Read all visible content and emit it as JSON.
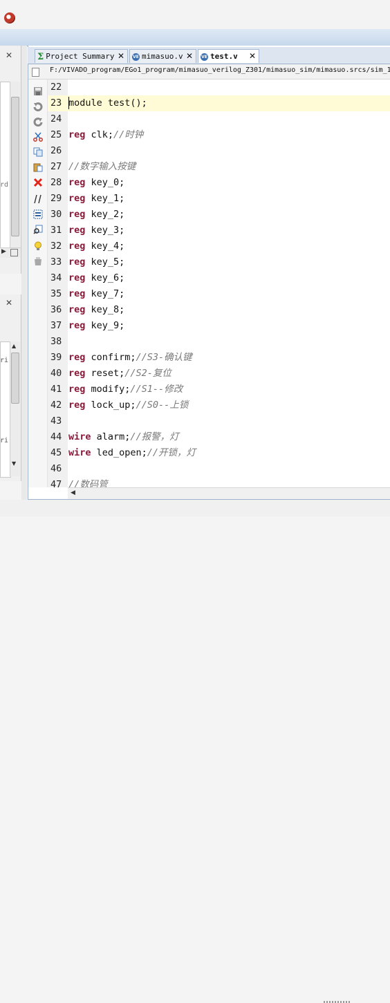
{
  "window": {
    "app_icon": "app-logo-icon"
  },
  "left_panel": {
    "top_hint_text": "rd",
    "bottom_text_1": "ri",
    "bottom_text_2": "ri"
  },
  "tabs": [
    {
      "label": "Project Summary",
      "icon": "sigma-icon",
      "active": false
    },
    {
      "label": "mimasuo.v",
      "icon": "verilog-file-icon",
      "active": false
    },
    {
      "label": "test.v",
      "icon": "verilog-file-icon",
      "active": true
    }
  ],
  "editor": {
    "path": "F:/VIVADO_program/EGo1_program/mimasuo_verilog_Z301/mimasuo_sim/mimasuo.srcs/sim_1",
    "tools": [
      "save-icon",
      "undo-icon",
      "redo-icon",
      "cut-icon",
      "copy-icon",
      "paste-icon",
      "delete-icon",
      "comment-icon",
      "select-all-icon",
      "find-replace-icon",
      "lightbulb-icon",
      "clear-icon"
    ],
    "lines": [
      {
        "num": "22",
        "kw": "",
        "rest": "",
        "comment": ""
      },
      {
        "num": "23",
        "kw": "",
        "rest": "module test();",
        "comment": ""
      },
      {
        "num": "24",
        "kw": "",
        "rest": "",
        "comment": ""
      },
      {
        "num": "25",
        "kw": "reg",
        "rest": " clk;",
        "comment": "//时钟"
      },
      {
        "num": "26",
        "kw": "",
        "rest": "",
        "comment": ""
      },
      {
        "num": "27",
        "kw": "",
        "rest": "",
        "comment": "//数字输入按键"
      },
      {
        "num": "28",
        "kw": "reg",
        "rest": " key_0;",
        "comment": ""
      },
      {
        "num": "29",
        "kw": "reg",
        "rest": " key_1;",
        "comment": ""
      },
      {
        "num": "30",
        "kw": "reg",
        "rest": " key_2;",
        "comment": ""
      },
      {
        "num": "31",
        "kw": "reg",
        "rest": " key_3;",
        "comment": ""
      },
      {
        "num": "32",
        "kw": "reg",
        "rest": " key_4;",
        "comment": ""
      },
      {
        "num": "33",
        "kw": "reg",
        "rest": " key_5;",
        "comment": ""
      },
      {
        "num": "34",
        "kw": "reg",
        "rest": " key_6;",
        "comment": ""
      },
      {
        "num": "35",
        "kw": "reg",
        "rest": " key_7;",
        "comment": ""
      },
      {
        "num": "36",
        "kw": "reg",
        "rest": " key_8;",
        "comment": ""
      },
      {
        "num": "37",
        "kw": "reg",
        "rest": " key_9;",
        "comment": ""
      },
      {
        "num": "38",
        "kw": "",
        "rest": "",
        "comment": ""
      },
      {
        "num": "39",
        "kw": "reg",
        "rest": " confirm;",
        "comment": "//S3-确认键"
      },
      {
        "num": "40",
        "kw": "reg",
        "rest": " reset;",
        "comment": "//S2-复位"
      },
      {
        "num": "41",
        "kw": "reg",
        "rest": " modify;",
        "comment": "//S1--修改"
      },
      {
        "num": "42",
        "kw": "reg",
        "rest": " lock_up;",
        "comment": "//S0--上锁"
      },
      {
        "num": "43",
        "kw": "",
        "rest": "",
        "comment": ""
      },
      {
        "num": "44",
        "kw": "wire",
        "rest": " alarm;",
        "comment": "//报警，灯"
      },
      {
        "num": "45",
        "kw": "wire",
        "rest": " led_open;",
        "comment": "//开锁，灯"
      },
      {
        "num": "46",
        "kw": "",
        "rest": "",
        "comment": ""
      },
      {
        "num": "47",
        "kw": "",
        "rest": "",
        "comment": "//数码管"
      }
    ],
    "current_line": "23"
  },
  "colors": {
    "keyword": "#8b1a3a",
    "comment": "#7a7a7a",
    "highlight": "#fffbd6",
    "tab_border": "#a5b8cf"
  }
}
